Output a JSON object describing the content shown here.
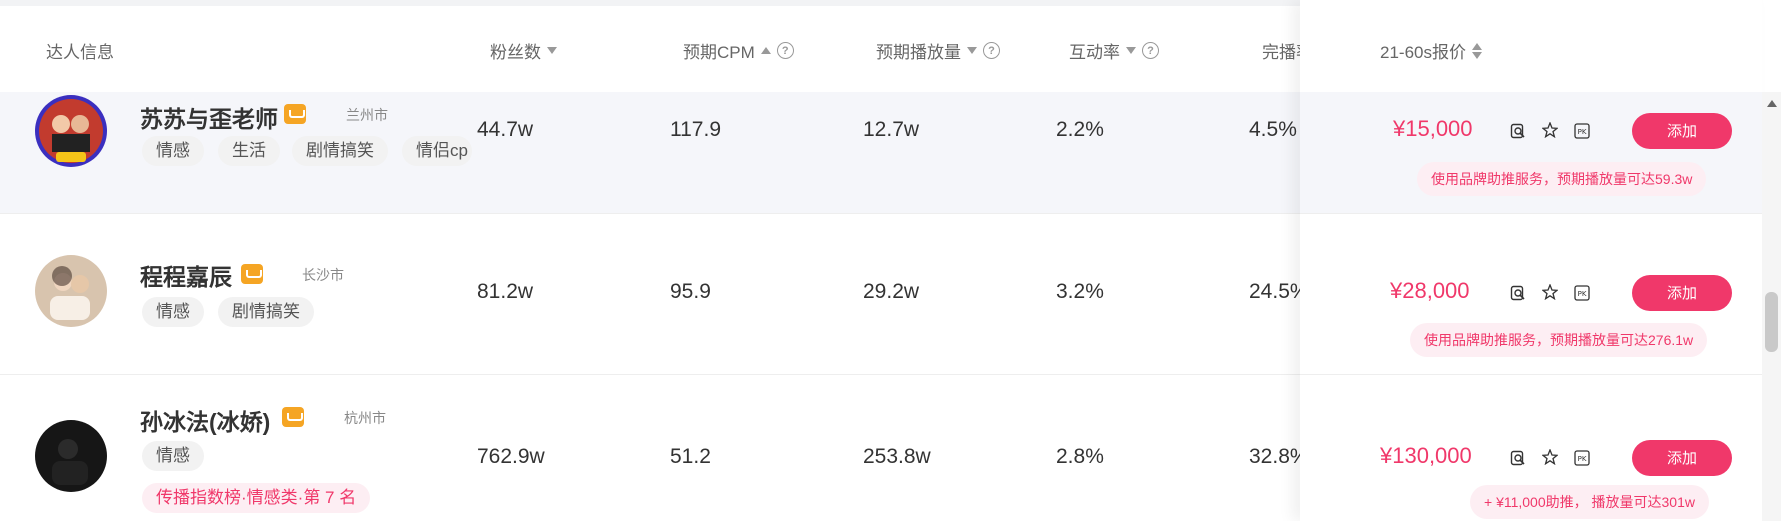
{
  "header": {
    "influencer_info": "达人信息",
    "followers": "粉丝数",
    "expected_cpm": "预期CPM",
    "expected_plays": "预期播放量",
    "engagement_rate": "互动率",
    "completion_rate": "完播率",
    "price_21_60s": "21-60s报价"
  },
  "rows": [
    {
      "name": "苏苏与歪老师",
      "city": "兰州市",
      "tags": [
        "情感",
        "生活",
        "剧情搞笑",
        "情侣cp"
      ],
      "followers": "44.7w",
      "cpm": "117.9",
      "plays": "12.7w",
      "engagement": "2.2%",
      "completion": "4.5%",
      "price": "¥15,000",
      "add_label": "添加",
      "promo": "使用品牌助推服务，预期播放量可达59.3w"
    },
    {
      "name": "程程嘉辰",
      "city": "长沙市",
      "tags": [
        "情感",
        "剧情搞笑"
      ],
      "followers": "81.2w",
      "cpm": "95.9",
      "plays": "29.2w",
      "engagement": "3.2%",
      "completion": "24.5%",
      "price": "¥28,000",
      "add_label": "添加",
      "promo": "使用品牌助推服务，预期播放量可达276.1w"
    },
    {
      "name": "孙冰法(冰娇)",
      "city": "杭州市",
      "tags": [
        "情感"
      ],
      "rank_badge": "传播指数榜·情感类·第 7 名",
      "followers": "762.9w",
      "cpm": "51.2",
      "plays": "253.8w",
      "engagement": "2.8%",
      "completion": "32.8%",
      "price": "¥130,000",
      "add_label": "添加",
      "promo": "+ ¥11,000助推， 播放量可达301w"
    }
  ],
  "icons": {
    "shop": "shopping-cart-icon",
    "detail": "search-detail-icon",
    "favorite": "star-icon",
    "compare": "pk-icon",
    "help": "question-circle-icon"
  },
  "colors": {
    "accent": "#f0386a",
    "shop_badge": "#f5a524"
  }
}
